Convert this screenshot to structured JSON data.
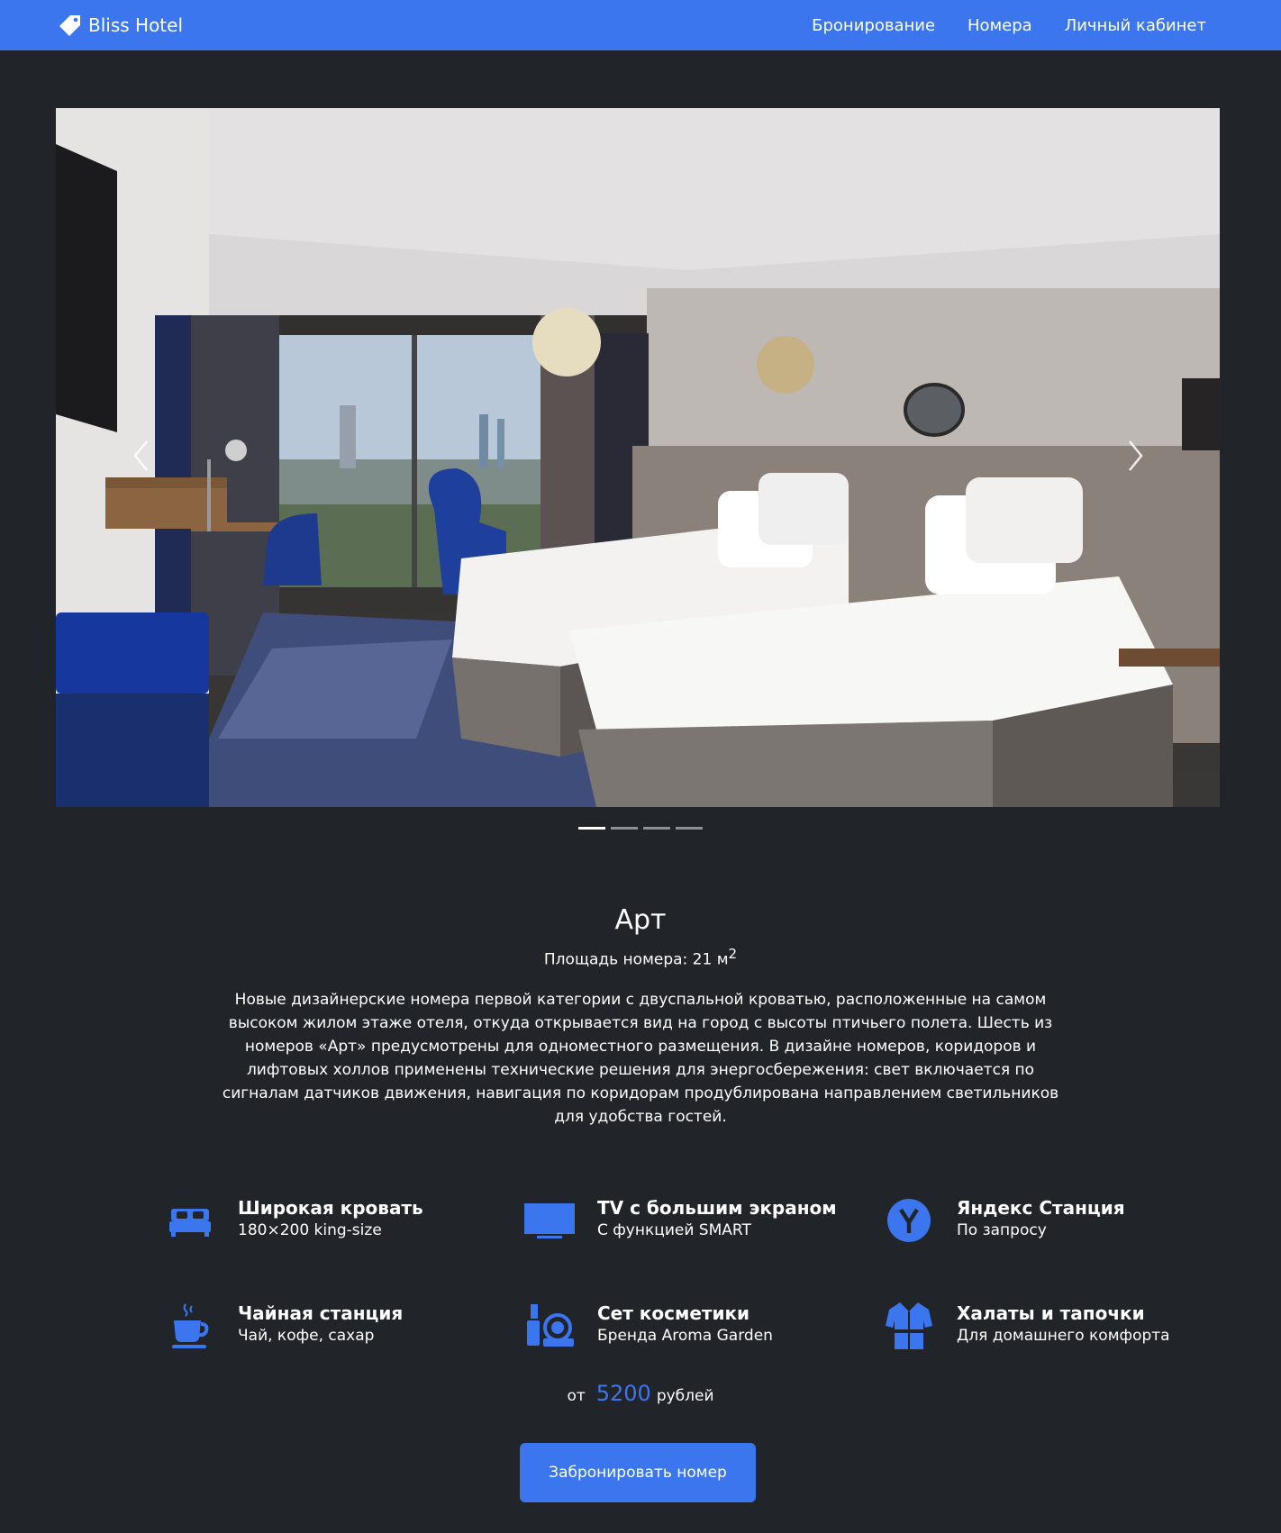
{
  "navbar": {
    "brand": "Bliss Hotel",
    "links": [
      "Бронирование",
      "Номера",
      "Личный кабинет"
    ]
  },
  "carousel": {
    "slides_count": 4,
    "active_index": 0
  },
  "room": {
    "title": "Арт",
    "area_label": "Площадь номера: 21 м",
    "area_sup": "2",
    "description": "Новые дизайнерские номера первой категории с двуспальной кроватью, расположенные на самом высоком жилом этаже отеля, откуда открывается вид на город с высоты птичьего полета. Шесть из номеров «Арт» предусмотрены для одноместного размещения. В дизайне номеров, коридоров и лифтовых холлов применены технические решения для энергосбережения: свет включается по сигналам датчиков движения, навигация по коридорам продублирована направлением светильников для удобства гостей."
  },
  "features": [
    {
      "icon": "bed-icon",
      "title": "Широкая кровать",
      "subtitle": "180×200 king-size"
    },
    {
      "icon": "tv-icon",
      "title": "TV с большим экраном",
      "subtitle": "С функцией SMART"
    },
    {
      "icon": "yandex-station-icon",
      "title": "Яндекс Станция",
      "subtitle": "По запросу"
    },
    {
      "icon": "tea-cup-icon",
      "title": "Чайная станция",
      "subtitle": "Чай, кофе, сахар"
    },
    {
      "icon": "cosmetics-icon",
      "title": "Сет косметики",
      "subtitle": "Бренда Aroma Garden"
    },
    {
      "icon": "bathrobe-icon",
      "title": "Халаты и тапочки",
      "subtitle": "Для домашнего комфорта"
    }
  ],
  "price": {
    "prefix": "от",
    "amount": "5200",
    "currency": "рублей"
  },
  "book_button": "Забронировать номер",
  "colors": {
    "accent": "#3b76ef",
    "background": "#212529",
    "text": "#ffffff"
  }
}
